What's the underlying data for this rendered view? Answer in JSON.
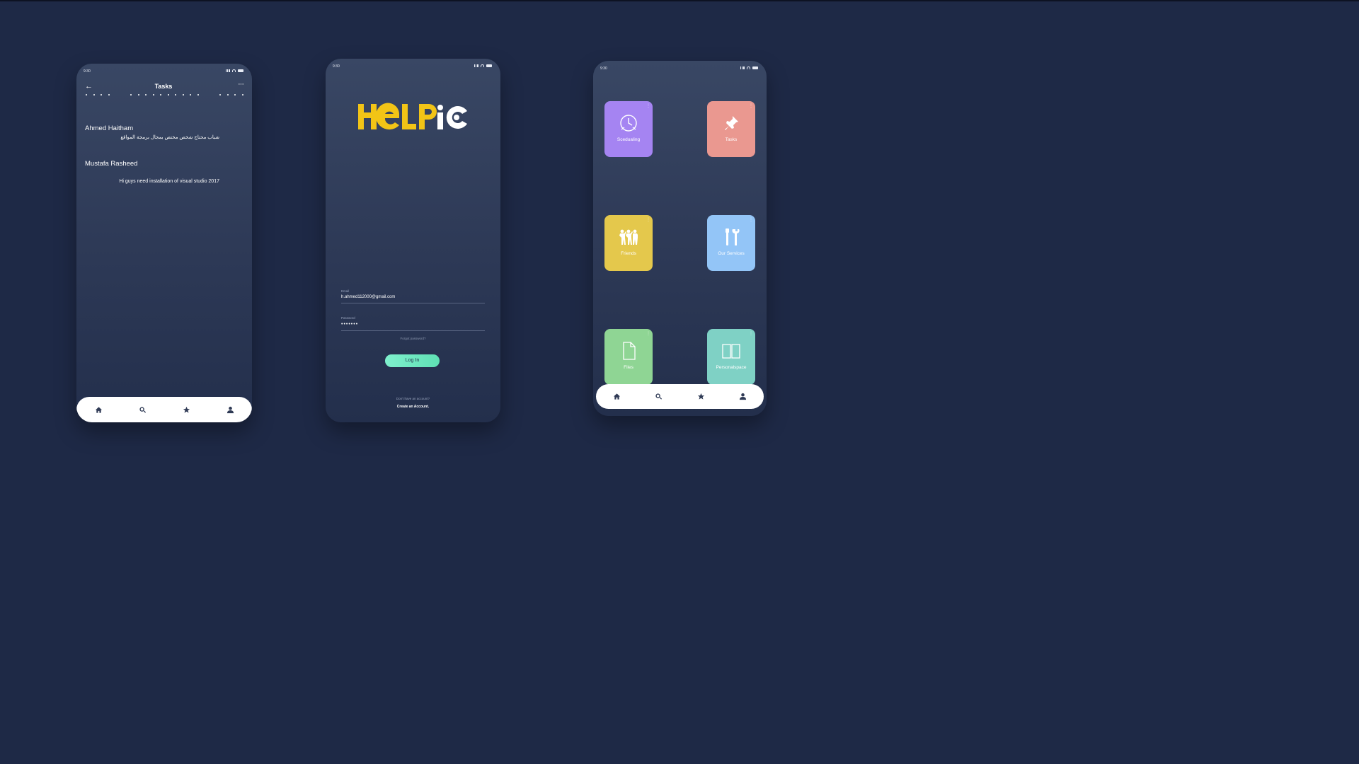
{
  "status_bar": {
    "time": "9:30"
  },
  "tasks_screen": {
    "title": "Tasks",
    "items": [
      {
        "name": "Ahmed Haitham",
        "message": "شباب محتاج شخص مختص بمجال برمجة المواقع"
      },
      {
        "name": "Mustafa Rasheed",
        "message": "Hi guys need installation of visual studio 2017"
      }
    ]
  },
  "login_screen": {
    "brand_text": "HELPIC",
    "email_label": "Email",
    "email_value": "h.ahmed112000@gmail.com",
    "password_label": "Password",
    "password_value": "•••••••",
    "forgot_password": "Forgot password?",
    "login_button": "Log In",
    "no_account_text": "Don't have an account?",
    "create_account": "Create an Account."
  },
  "home_screen": {
    "tiles": [
      {
        "label": "Scedualing",
        "color": "#a584f2",
        "icon": "clock-icon"
      },
      {
        "label": "Tasks",
        "color": "#ea9890",
        "icon": "pin-icon"
      },
      {
        "label": "Friends",
        "color": "#e4c84c",
        "icon": "people-icon"
      },
      {
        "label": "Our Services",
        "color": "#93c5f7",
        "icon": "tools-icon"
      },
      {
        "label": "Files",
        "color": "#8fd594",
        "icon": "file-icon"
      },
      {
        "label": "Personalspace",
        "color": "#7fd1c5",
        "icon": "book-icon"
      }
    ]
  },
  "tab_bar": [
    "home-icon",
    "search-icon",
    "star-icon",
    "profile-icon"
  ],
  "colors": {
    "background": "#1e2946",
    "accent_green": "#5fe0b4",
    "logo_yellow": "#f2c416"
  }
}
